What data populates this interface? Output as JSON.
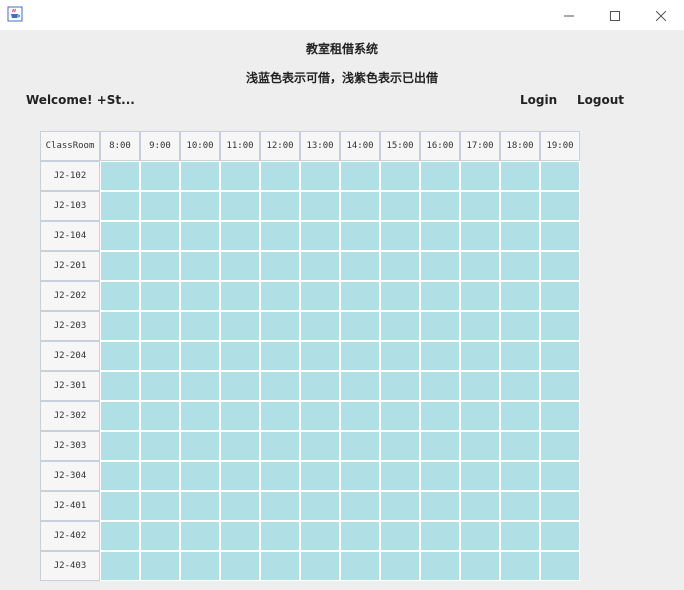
{
  "window": {
    "icon": "java-cup-icon",
    "controls": [
      "minimize",
      "maximize",
      "close"
    ]
  },
  "header": {
    "title": "教室租借系统",
    "legend": "浅蓝色表示可借，浅紫色表示已出借",
    "welcome": "Welcome! +St...",
    "login_label": "Login",
    "logout_label": "Logout"
  },
  "table": {
    "corner_label": "ClassRoom",
    "times": [
      "8:00",
      "9:00",
      "10:00",
      "11:00",
      "12:00",
      "13:00",
      "14:00",
      "15:00",
      "16:00",
      "17:00",
      "18:00",
      "19:00"
    ],
    "rooms": [
      "J2-102",
      "J2-103",
      "J2-104",
      "J2-201",
      "J2-202",
      "J2-203",
      "J2-204",
      "J2-301",
      "J2-302",
      "J2-303",
      "J2-304",
      "J2-401",
      "J2-402",
      "J2-403"
    ],
    "status_colors": {
      "available": "#b0dfe5",
      "borrowed": "#d9c6e8"
    }
  }
}
